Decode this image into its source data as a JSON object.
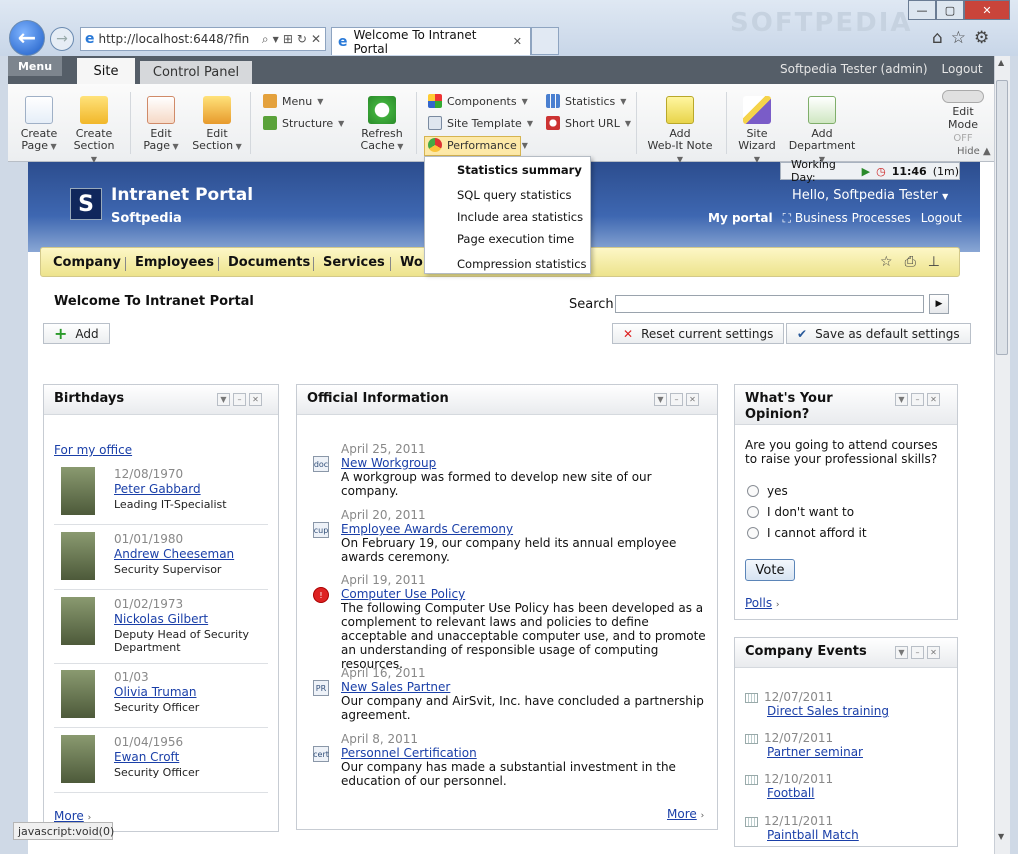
{
  "browser": {
    "address": "http://localhost:6448/?fin",
    "tab_title": "Welcome To Intranet Portal",
    "watermark": "SOFTPEDIA",
    "status_text": "javascript:void(0)"
  },
  "toolbar": {
    "menu_label": "Menu",
    "tabs": [
      "Site",
      "Control Panel"
    ],
    "user": "Softpedia Tester (admin)",
    "logout": "Logout",
    "buttons": {
      "create_page": [
        "Create",
        "Page"
      ],
      "create_section": [
        "Create",
        "Section"
      ],
      "edit_page": [
        "Edit",
        "Page"
      ],
      "edit_section": [
        "Edit",
        "Section"
      ],
      "menu": "Menu",
      "structure": "Structure",
      "refresh_cache": [
        "Refresh",
        "Cache"
      ],
      "components": "Components",
      "site_template": "Site Template",
      "performance": "Performance",
      "statistics": "Statistics",
      "short_url": "Short URL",
      "add_webit_note": [
        "Add",
        "Web-It Note"
      ],
      "site_wizard": [
        "Site",
        "Wizard"
      ],
      "add_department": [
        "Add",
        "Department"
      ]
    },
    "edit_mode": "Edit Mode",
    "edit_mode_state": "OFF",
    "hide": "Hide"
  },
  "dropdown": [
    "Statistics summary",
    "SQL query statistics",
    "Include area statistics",
    "Page execution time",
    "Compression statistics"
  ],
  "header": {
    "working_day": "Working Day:",
    "time": "11:46",
    "time_suffix": "(1m)",
    "site_title": "Intranet Portal",
    "site_subtitle": "Softpedia",
    "greeting": "Hello, Softpedia Tester",
    "links": [
      "My portal",
      "Business Processes",
      "Logout"
    ],
    "logo_letter": "S"
  },
  "nav": [
    "Company",
    "Employees",
    "Documents",
    "Services",
    "Wo"
  ],
  "main": {
    "title": "Welcome To Intranet Portal",
    "search_label": "Search",
    "add": "Add",
    "reset": "Reset current settings",
    "save": "Save as default settings"
  },
  "birthdays": {
    "title": "Birthdays",
    "filter": "For my office",
    "items": [
      {
        "date": "12/08/1970",
        "name": "Peter Gabbard",
        "role": "Leading IT-Specialist"
      },
      {
        "date": "01/01/1980",
        "name": "Andrew Cheeseman",
        "role": "Security Supervisor"
      },
      {
        "date": "01/02/1973",
        "name": "Nickolas Gilbert",
        "role": "Deputy Head of Security Department"
      },
      {
        "date": "01/03",
        "name": "Olivia Truman",
        "role": "Security Officer"
      },
      {
        "date": "01/04/1956",
        "name": "Ewan Croft",
        "role": "Security Officer"
      }
    ],
    "more": "More"
  },
  "official": {
    "title": "Official Information",
    "items": [
      {
        "date": "April 25, 2011",
        "title": "New Workgroup",
        "text": "A workgroup was formed to develop new site of our company."
      },
      {
        "date": "April 20, 2011",
        "title": "Employee Awards Ceremony",
        "text": "On February 19, our company held its annual employee awards ceremony."
      },
      {
        "date": "April 19, 2011",
        "title": "Computer Use Policy",
        "text": "The following Computer Use Policy has been developed as a complement to relevant laws and policies to define acceptable and unacceptable computer use, and to promote an understanding of responsible usage of computing resources."
      },
      {
        "date": "April 16, 2011",
        "title": "New Sales Partner",
        "text": "Our company and AirSvit, Inc. have concluded a partnership agreement."
      },
      {
        "date": "April 8, 2011",
        "title": "Personnel Certification",
        "text": "Our company has made a substantial investment in the education of our personnel."
      }
    ],
    "icons": [
      "doc",
      "cup",
      "!",
      "PR",
      "cert"
    ],
    "more": "More"
  },
  "opinion": {
    "title": "What's Your Opinion?",
    "question": "Are you going to attend courses to raise your professional skills?",
    "options": [
      "yes",
      "I don't want to",
      "I cannot afford it"
    ],
    "vote": "Vote",
    "polls": "Polls"
  },
  "events": {
    "title": "Company Events",
    "items": [
      {
        "date": "12/07/2011",
        "title": "Direct Sales training"
      },
      {
        "date": "12/07/2011",
        "title": "Partner seminar"
      },
      {
        "date": "12/10/2011",
        "title": "Football"
      },
      {
        "date": "12/11/2011",
        "title": "Paintball Match"
      }
    ]
  },
  "colors": {
    "accent": "#3e67b1",
    "navbar": "#f4eca8",
    "link": "#1a3fa8"
  }
}
